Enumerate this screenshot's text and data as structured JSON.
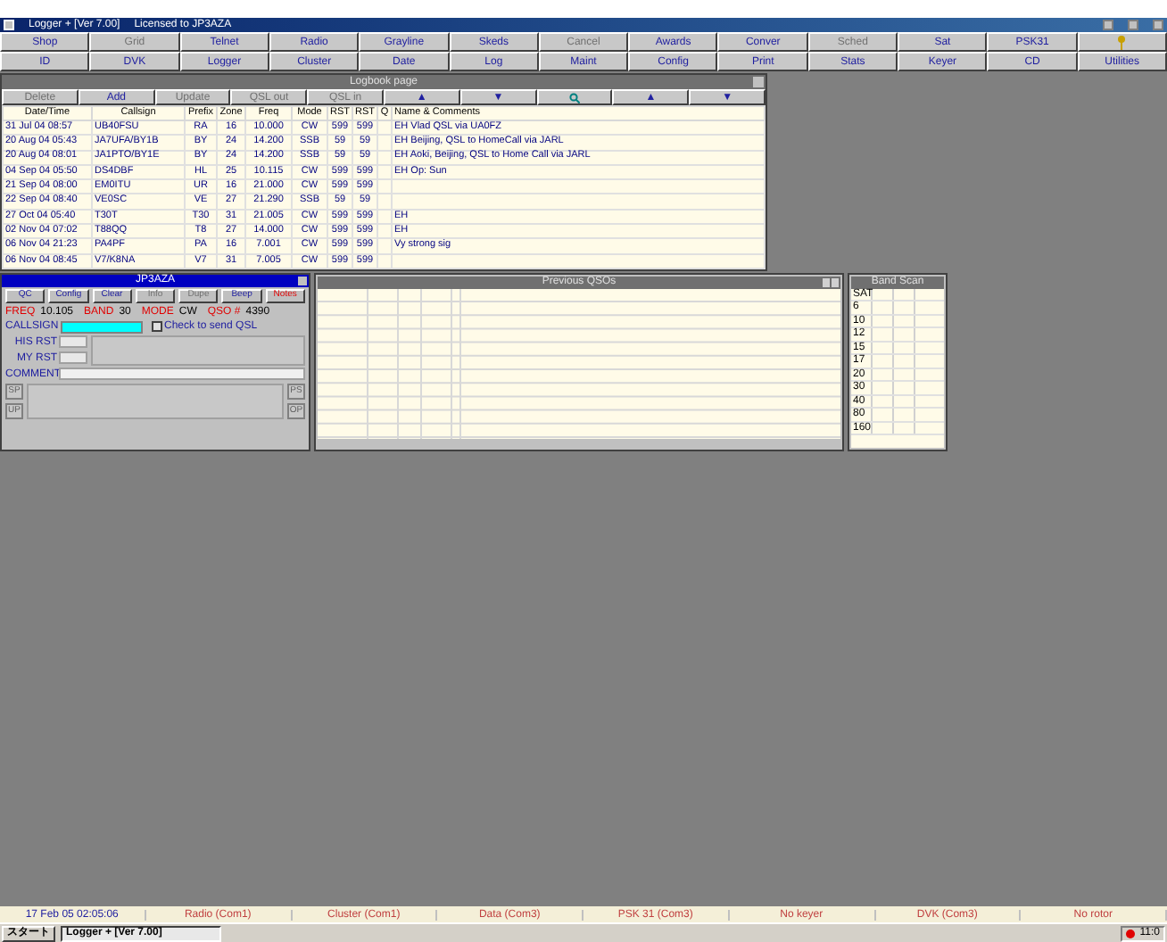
{
  "window": {
    "title": "Logger + [Ver 7.00]",
    "license": "Licensed to JP3AZA"
  },
  "toolbar": [
    [
      {
        "label": "Shop",
        "disabled": false
      },
      {
        "label": "Grid",
        "disabled": true
      },
      {
        "label": "Telnet",
        "disabled": false
      },
      {
        "label": "Radio",
        "disabled": false
      },
      {
        "label": "Grayline",
        "disabled": false
      },
      {
        "label": "Skeds",
        "disabled": false
      },
      {
        "label": "Cancel",
        "disabled": true
      },
      {
        "label": "Awards",
        "disabled": false
      },
      {
        "label": "Conver",
        "disabled": false
      },
      {
        "label": "Sched",
        "disabled": true
      },
      {
        "label": "Sat",
        "disabled": false
      },
      {
        "label": "PSK31",
        "disabled": false
      },
      {
        "kind": "key"
      }
    ],
    [
      {
        "label": "ID",
        "disabled": false
      },
      {
        "label": "DVK",
        "disabled": false
      },
      {
        "label": "Logger",
        "disabled": false
      },
      {
        "label": "Cluster",
        "disabled": false
      },
      {
        "label": "Date",
        "disabled": false
      },
      {
        "label": "Log",
        "disabled": false
      },
      {
        "label": "Maint",
        "disabled": false
      },
      {
        "label": "Config",
        "disabled": false
      },
      {
        "label": "Print",
        "disabled": false
      },
      {
        "label": "Stats",
        "disabled": false
      },
      {
        "label": "Keyer",
        "disabled": false
      },
      {
        "label": "CD",
        "disabled": false
      },
      {
        "label": "Utilities",
        "disabled": false
      }
    ]
  ],
  "logbook": {
    "title": "Logbook page",
    "buttons": [
      {
        "label": "Delete",
        "disabled": true
      },
      {
        "label": "Add",
        "disabled": false
      },
      {
        "label": "Update",
        "disabled": true
      },
      {
        "label": "QSL out",
        "disabled": true
      },
      {
        "label": "QSL in",
        "disabled": true
      },
      {
        "label": "▲",
        "disabled": false
      },
      {
        "label": "▼",
        "disabled": false
      },
      {
        "kind": "search"
      },
      {
        "label": "▲",
        "disabled": false
      },
      {
        "label": "▼",
        "disabled": false
      }
    ],
    "columns": [
      "Date/Time",
      "Callsign",
      "Prefix",
      "Zone",
      "Freq",
      "Mode",
      "RST",
      "RST",
      "Q",
      "Name & Comments"
    ],
    "rows": [
      [
        "31 Jul 04 08:57",
        "UB40FSU",
        "RA",
        "16",
        "10.000",
        "CW",
        "599",
        "599",
        "",
        "EH Vlad QSL via UA0FZ"
      ],
      [
        "20 Aug 04 05:43",
        "JA7UFA/BY1B",
        "BY",
        "24",
        "14.200",
        "SSB",
        "59",
        "59",
        "",
        "EH Beijing, QSL to HomeCall via JARL"
      ],
      [
        "20 Aug 04 08:01",
        "JA1PTO/BY1E",
        "BY",
        "24",
        "14.200",
        "SSB",
        "59",
        "59",
        "",
        "EH Aoki, Beijing, QSL to Home Call via JARL"
      ],
      [
        "04 Sep 04 05:50",
        "DS4DBF",
        "HL",
        "25",
        "10.115",
        "CW",
        "599",
        "599",
        "",
        "EH Op: Sun"
      ],
      [
        "21 Sep 04 08:00",
        "EM0ITU",
        "UR",
        "16",
        "21.000",
        "CW",
        "599",
        "599",
        "",
        ""
      ],
      [
        "22 Sep 04 08:40",
        "VE0SC",
        "VE",
        "27",
        "21.290",
        "SSB",
        "59",
        "59",
        "",
        ""
      ],
      [
        "27 Oct 04 05:40",
        "T30T",
        "T30",
        "31",
        "21.005",
        "CW",
        "599",
        "599",
        "",
        "EH"
      ],
      [
        "02 Nov 04 07:02",
        "T88QQ",
        "T8",
        "27",
        "14.000",
        "CW",
        "599",
        "599",
        "",
        "EH"
      ],
      [
        "06 Nov 04 21:23",
        "PA4PF",
        "PA",
        "16",
        "7.001",
        "CW",
        "599",
        "599",
        "",
        "Vy strong sig"
      ],
      [
        "06 Nov 04 08:45",
        "V7/K8NA",
        "V7",
        "31",
        "7.005",
        "CW",
        "599",
        "599",
        "",
        ""
      ]
    ]
  },
  "qso": {
    "title": "JP3AZA",
    "buttons": [
      {
        "label": "QC",
        "disabled": false,
        "alert": false
      },
      {
        "label": "Config",
        "disabled": false,
        "alert": false
      },
      {
        "label": "Clear",
        "disabled": false,
        "alert": false
      },
      {
        "label": "Info",
        "disabled": true,
        "alert": false
      },
      {
        "label": "Dupe",
        "disabled": true,
        "alert": false
      },
      {
        "label": "Beep",
        "disabled": false,
        "alert": false
      },
      {
        "label": "Notes",
        "disabled": false,
        "alert": true
      }
    ],
    "readouts": [
      {
        "label": "FREQ",
        "value": "10.105"
      },
      {
        "label": "BAND",
        "value": "30"
      },
      {
        "label": "MODE",
        "value": "CW"
      },
      {
        "label": "QSO #",
        "value": "4390"
      }
    ],
    "callsign_label": "CALLSIGN",
    "send_qsl": {
      "label": "Check to send QSL",
      "checked": false
    },
    "his_rst": "HIS RST",
    "my_rst": "MY RST",
    "comment": "COMMENT",
    "side_buttons": [
      {
        "label": "SP",
        "disabled": true
      },
      {
        "label": "UP",
        "disabled": true
      },
      {
        "label": "PS",
        "disabled": true
      },
      {
        "label": "OP",
        "disabled": true
      }
    ]
  },
  "previous_qsos": {
    "title": "Previous QSOs"
  },
  "band_scan": {
    "title": "Band Scan",
    "bands": [
      "SAT",
      "6",
      "10",
      "12",
      "15",
      "17",
      "20",
      "30",
      "40",
      "80",
      "160"
    ]
  },
  "status_bar": [
    "17 Feb 05 02:05:06",
    "Radio (Com1)",
    "Cluster (Com1)",
    "Data (Com3)",
    "PSK 31 (Com3)",
    "No keyer",
    "DVK (Com3)",
    "No rotor"
  ],
  "taskbar": {
    "start": "スタート",
    "task": "Logger + [Ver 7.00]",
    "clock": "11:0"
  }
}
